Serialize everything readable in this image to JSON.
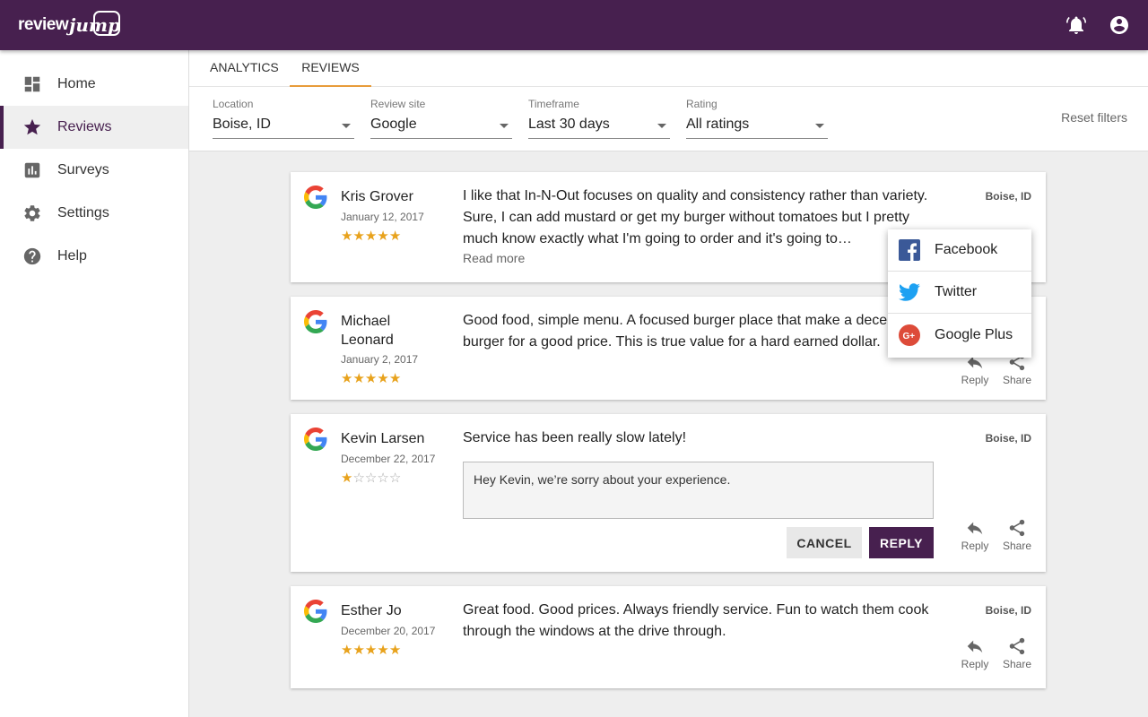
{
  "app": {
    "logo_text_1": "review",
    "logo_text_2": "jump"
  },
  "topbar": {
    "icons": [
      "bell-icon",
      "account-icon"
    ]
  },
  "sidebar": {
    "items": [
      {
        "label": "Home",
        "icon": "dashboard-icon"
      },
      {
        "label": "Reviews",
        "icon": "star-icon"
      },
      {
        "label": "Surveys",
        "icon": "bar-chart-icon"
      },
      {
        "label": "Settings",
        "icon": "gear-icon"
      },
      {
        "label": "Help",
        "icon": "help-icon"
      }
    ]
  },
  "tabs": [
    {
      "label": "ANALYTICS"
    },
    {
      "label": "REVIEWS"
    }
  ],
  "filters": [
    {
      "label": "Location",
      "value": "Boise, ID"
    },
    {
      "label": "Review site",
      "value": "Google"
    },
    {
      "label": "Timeframe",
      "value": "Last 30 days"
    },
    {
      "label": "Rating",
      "value": "All ratings"
    }
  ],
  "reset_label": "Reset filters",
  "actions": {
    "reply": "Reply",
    "share": "Share"
  },
  "reviews": [
    {
      "name": "Kris Grover",
      "date": "January 12, 2017",
      "rating": 5,
      "text": "I like that In-N-Out focuses on quality and consistency rather than variety. Sure, I can add mustard or get my burger without tomatoes but I pretty much know exactly what I'm going to order and it's going to…",
      "read_more": "Read more",
      "location": "Boise, ID"
    },
    {
      "name": "Michael Leonard",
      "date": "January 2, 2017",
      "rating": 5,
      "text": "Good food, simple menu.  A focused burger place that make a decent burger for a good price.  This is true value for a hard earned dollar."
    },
    {
      "name": "Kevin Larsen",
      "date": "December 22, 2017",
      "rating": 1,
      "text": "Service has been really slow lately!",
      "location": "Boise, ID",
      "reply_draft": "Hey Kevin, we’re sorry about your experience.",
      "cancel_label": "CANCEL",
      "reply_label": "REPLY"
    },
    {
      "name": "Esther Jo",
      "date": "December 20, 2017",
      "rating": 5,
      "text": "Great food. Good prices. Always friendly service. Fun to watch them cook through the windows at the drive through.",
      "location": "Boise, ID"
    }
  ],
  "share_menu": [
    {
      "label": "Facebook",
      "icon": "facebook-icon",
      "color": "#3b5998"
    },
    {
      "label": "Twitter",
      "icon": "twitter-icon",
      "color": "#1da1f2"
    },
    {
      "label": "Google Plus",
      "icon": "google-plus-icon",
      "color": "#dd4b39"
    }
  ],
  "colors": {
    "brand": "#47204f",
    "accent": "#e89c3a",
    "star": "#e8a21c"
  }
}
